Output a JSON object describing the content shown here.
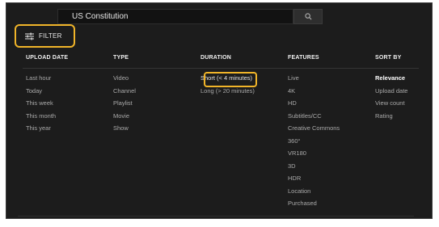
{
  "search": {
    "query": "US Constitution"
  },
  "filter": {
    "label": "FILTER"
  },
  "columns": [
    {
      "header": "UPLOAD DATE",
      "options": [
        "Last hour",
        "Today",
        "This week",
        "This month",
        "This year"
      ]
    },
    {
      "header": "TYPE",
      "options": [
        "Video",
        "Channel",
        "Playlist",
        "Movie",
        "Show"
      ]
    },
    {
      "header": "DURATION",
      "options": [
        "Short (< 4 minutes)",
        "Long (> 20 minutes)"
      ]
    },
    {
      "header": "FEATURES",
      "options": [
        "Live",
        "4K",
        "HD",
        "Subtitles/CC",
        "Creative Commons",
        "360°",
        "VR180",
        "3D",
        "HDR",
        "Location",
        "Purchased"
      ]
    },
    {
      "header": "SORT BY",
      "options": [
        "Relevance",
        "Upload date",
        "View count",
        "Rating"
      ]
    }
  ],
  "colors": {
    "highlight": "#f0b429",
    "background": "#1c1c1c"
  }
}
